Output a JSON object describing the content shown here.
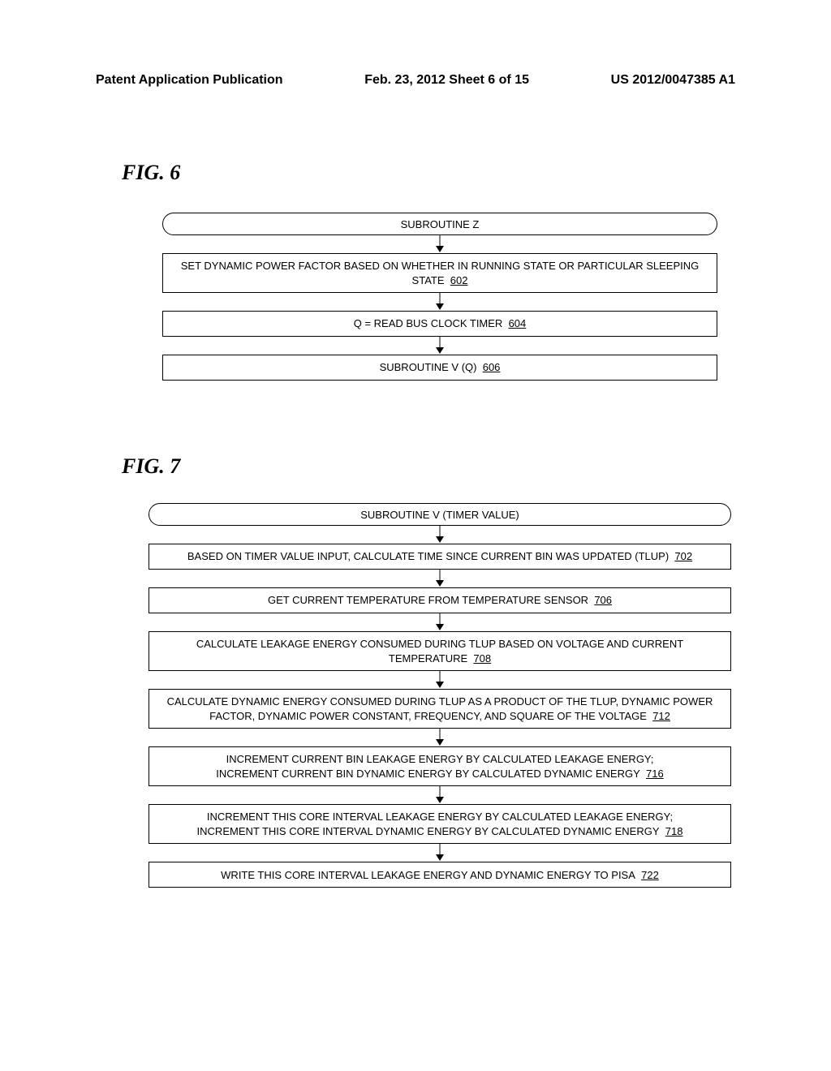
{
  "header": {
    "left": "Patent Application Publication",
    "mid": "Feb. 23, 2012  Sheet 6 of 15",
    "right": "US 2012/0047385 A1"
  },
  "fig6": {
    "label": "FIG. 6",
    "terminator": "SUBROUTINE Z",
    "steps": [
      {
        "text": "SET DYNAMIC POWER FACTOR BASED ON WHETHER IN RUNNING STATE OR PARTICULAR SLEEPING STATE",
        "ref": "602"
      },
      {
        "text": "Q = READ BUS CLOCK TIMER",
        "ref": "604"
      },
      {
        "text": "SUBROUTINE V (Q)",
        "ref": "606"
      }
    ]
  },
  "fig7": {
    "label": "FIG. 7",
    "terminator": "SUBROUTINE V (TIMER VALUE)",
    "steps": [
      {
        "text": "BASED ON TIMER VALUE INPUT, CALCULATE TIME SINCE CURRENT BIN WAS UPDATED (TLUP)",
        "ref": "702"
      },
      {
        "text": "GET CURRENT TEMPERATURE FROM TEMPERATURE SENSOR",
        "ref": "706"
      },
      {
        "text": "CALCULATE LEAKAGE ENERGY CONSUMED DURING TLUP BASED ON VOLTAGE  AND CURRENT TEMPERATURE",
        "ref": "708"
      },
      {
        "text": "CALCULATE DYNAMIC ENERGY CONSUMED DURING TLUP AS A PRODUCT OF THE TLUP, DYNAMIC POWER FACTOR, DYNAMIC POWER CONSTANT, FREQUENCY, AND SQUARE OF THE VOLTAGE",
        "ref": "712"
      },
      {
        "text": "INCREMENT CURRENT BIN LEAKAGE ENERGY BY CALCULATED LEAKAGE ENERGY;\nINCREMENT CURRENT BIN DYNAMIC ENERGY BY CALCULATED DYNAMIC ENERGY",
        "ref": "716"
      },
      {
        "text": "INCREMENT THIS CORE INTERVAL LEAKAGE ENERGY BY CALCULATED LEAKAGE ENERGY;\nINCREMENT THIS CORE INTERVAL DYNAMIC ENERGY BY CALCULATED DYNAMIC ENERGY",
        "ref": "718"
      },
      {
        "text": "WRITE THIS CORE INTERVAL LEAKAGE ENERGY AND DYNAMIC ENERGY TO PISA",
        "ref": "722"
      }
    ]
  }
}
